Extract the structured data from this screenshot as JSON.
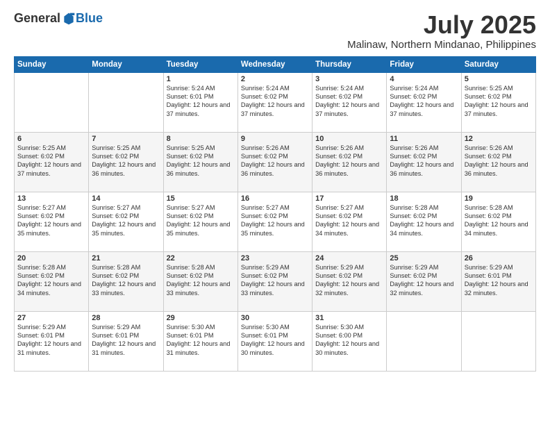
{
  "logo": {
    "general": "General",
    "blue": "Blue"
  },
  "title": {
    "month": "July 2025",
    "location": "Malinaw, Northern Mindanao, Philippines"
  },
  "headers": [
    "Sunday",
    "Monday",
    "Tuesday",
    "Wednesday",
    "Thursday",
    "Friday",
    "Saturday"
  ],
  "weeks": [
    [
      {
        "day": "",
        "info": ""
      },
      {
        "day": "",
        "info": ""
      },
      {
        "day": "1",
        "info": "Sunrise: 5:24 AM\nSunset: 6:01 PM\nDaylight: 12 hours and 37 minutes."
      },
      {
        "day": "2",
        "info": "Sunrise: 5:24 AM\nSunset: 6:02 PM\nDaylight: 12 hours and 37 minutes."
      },
      {
        "day": "3",
        "info": "Sunrise: 5:24 AM\nSunset: 6:02 PM\nDaylight: 12 hours and 37 minutes."
      },
      {
        "day": "4",
        "info": "Sunrise: 5:24 AM\nSunset: 6:02 PM\nDaylight: 12 hours and 37 minutes."
      },
      {
        "day": "5",
        "info": "Sunrise: 5:25 AM\nSunset: 6:02 PM\nDaylight: 12 hours and 37 minutes."
      }
    ],
    [
      {
        "day": "6",
        "info": "Sunrise: 5:25 AM\nSunset: 6:02 PM\nDaylight: 12 hours and 37 minutes."
      },
      {
        "day": "7",
        "info": "Sunrise: 5:25 AM\nSunset: 6:02 PM\nDaylight: 12 hours and 36 minutes."
      },
      {
        "day": "8",
        "info": "Sunrise: 5:25 AM\nSunset: 6:02 PM\nDaylight: 12 hours and 36 minutes."
      },
      {
        "day": "9",
        "info": "Sunrise: 5:26 AM\nSunset: 6:02 PM\nDaylight: 12 hours and 36 minutes."
      },
      {
        "day": "10",
        "info": "Sunrise: 5:26 AM\nSunset: 6:02 PM\nDaylight: 12 hours and 36 minutes."
      },
      {
        "day": "11",
        "info": "Sunrise: 5:26 AM\nSunset: 6:02 PM\nDaylight: 12 hours and 36 minutes."
      },
      {
        "day": "12",
        "info": "Sunrise: 5:26 AM\nSunset: 6:02 PM\nDaylight: 12 hours and 36 minutes."
      }
    ],
    [
      {
        "day": "13",
        "info": "Sunrise: 5:27 AM\nSunset: 6:02 PM\nDaylight: 12 hours and 35 minutes."
      },
      {
        "day": "14",
        "info": "Sunrise: 5:27 AM\nSunset: 6:02 PM\nDaylight: 12 hours and 35 minutes."
      },
      {
        "day": "15",
        "info": "Sunrise: 5:27 AM\nSunset: 6:02 PM\nDaylight: 12 hours and 35 minutes."
      },
      {
        "day": "16",
        "info": "Sunrise: 5:27 AM\nSunset: 6:02 PM\nDaylight: 12 hours and 35 minutes."
      },
      {
        "day": "17",
        "info": "Sunrise: 5:27 AM\nSunset: 6:02 PM\nDaylight: 12 hours and 34 minutes."
      },
      {
        "day": "18",
        "info": "Sunrise: 5:28 AM\nSunset: 6:02 PM\nDaylight: 12 hours and 34 minutes."
      },
      {
        "day": "19",
        "info": "Sunrise: 5:28 AM\nSunset: 6:02 PM\nDaylight: 12 hours and 34 minutes."
      }
    ],
    [
      {
        "day": "20",
        "info": "Sunrise: 5:28 AM\nSunset: 6:02 PM\nDaylight: 12 hours and 34 minutes."
      },
      {
        "day": "21",
        "info": "Sunrise: 5:28 AM\nSunset: 6:02 PM\nDaylight: 12 hours and 33 minutes."
      },
      {
        "day": "22",
        "info": "Sunrise: 5:28 AM\nSunset: 6:02 PM\nDaylight: 12 hours and 33 minutes."
      },
      {
        "day": "23",
        "info": "Sunrise: 5:29 AM\nSunset: 6:02 PM\nDaylight: 12 hours and 33 minutes."
      },
      {
        "day": "24",
        "info": "Sunrise: 5:29 AM\nSunset: 6:02 PM\nDaylight: 12 hours and 32 minutes."
      },
      {
        "day": "25",
        "info": "Sunrise: 5:29 AM\nSunset: 6:02 PM\nDaylight: 12 hours and 32 minutes."
      },
      {
        "day": "26",
        "info": "Sunrise: 5:29 AM\nSunset: 6:01 PM\nDaylight: 12 hours and 32 minutes."
      }
    ],
    [
      {
        "day": "27",
        "info": "Sunrise: 5:29 AM\nSunset: 6:01 PM\nDaylight: 12 hours and 31 minutes."
      },
      {
        "day": "28",
        "info": "Sunrise: 5:29 AM\nSunset: 6:01 PM\nDaylight: 12 hours and 31 minutes."
      },
      {
        "day": "29",
        "info": "Sunrise: 5:30 AM\nSunset: 6:01 PM\nDaylight: 12 hours and 31 minutes."
      },
      {
        "day": "30",
        "info": "Sunrise: 5:30 AM\nSunset: 6:01 PM\nDaylight: 12 hours and 30 minutes."
      },
      {
        "day": "31",
        "info": "Sunrise: 5:30 AM\nSunset: 6:00 PM\nDaylight: 12 hours and 30 minutes."
      },
      {
        "day": "",
        "info": ""
      },
      {
        "day": "",
        "info": ""
      }
    ]
  ]
}
